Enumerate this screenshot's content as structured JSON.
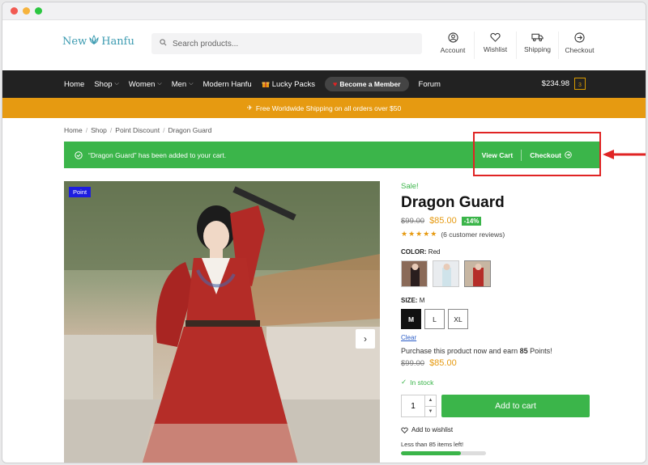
{
  "colors": {
    "accent": "#3bb54a",
    "promo": "#e69a11",
    "nav_bg": "#222222",
    "highlight": "#e02424",
    "point_badge": "#1d1de0"
  },
  "header": {
    "logo_text_a": "New",
    "logo_text_b": "Hanfu",
    "search_placeholder": "Search products...",
    "icons": [
      {
        "label": "Account",
        "icon": "user-circle-icon"
      },
      {
        "label": "Wishlist",
        "icon": "heart-icon"
      },
      {
        "label": "Shipping",
        "icon": "truck-icon"
      },
      {
        "label": "Checkout",
        "icon": "arrow-circle-icon"
      }
    ]
  },
  "nav": {
    "items": [
      "Home",
      "Shop",
      "Women",
      "Men",
      "Modern Hanfu",
      "Lucky Packs",
      "Become a Member",
      "Forum"
    ],
    "cart_total": "$234.98",
    "cart_count": "3"
  },
  "promo": {
    "text": "Free Worldwide Shipping on all orders over $50"
  },
  "breadcrumb": [
    "Home",
    "Shop",
    "Point Discount",
    "Dragon Guard"
  ],
  "notice": {
    "message": "“Dragon Guard” has been added to your cart.",
    "view_cart": "View Cart",
    "checkout": "Checkout"
  },
  "product": {
    "badge": "Point",
    "sale_label": "Sale!",
    "title": "Dragon Guard",
    "old_price": "$99.00",
    "new_price": "$85.00",
    "discount": "-14%",
    "rating": 5,
    "reviews": "(6 customer reviews)",
    "color_label": "COLOR:",
    "color_value": "Red",
    "size_label": "SIZE:",
    "size_value": "M",
    "sizes": [
      "M",
      "L",
      "XL"
    ],
    "clear": "Clear",
    "earn_text_a": "Purchase this product now and earn",
    "earn_points": "85",
    "earn_text_b": "Points!",
    "earn_old": "$99.00",
    "earn_new": "$85.00",
    "stock": "In stock",
    "qty": "1",
    "add_to_cart": "Add to cart",
    "wishlist": "Add to wishlist",
    "items_left": "Less than 85 items left!",
    "stock_fraction": 0.7
  }
}
